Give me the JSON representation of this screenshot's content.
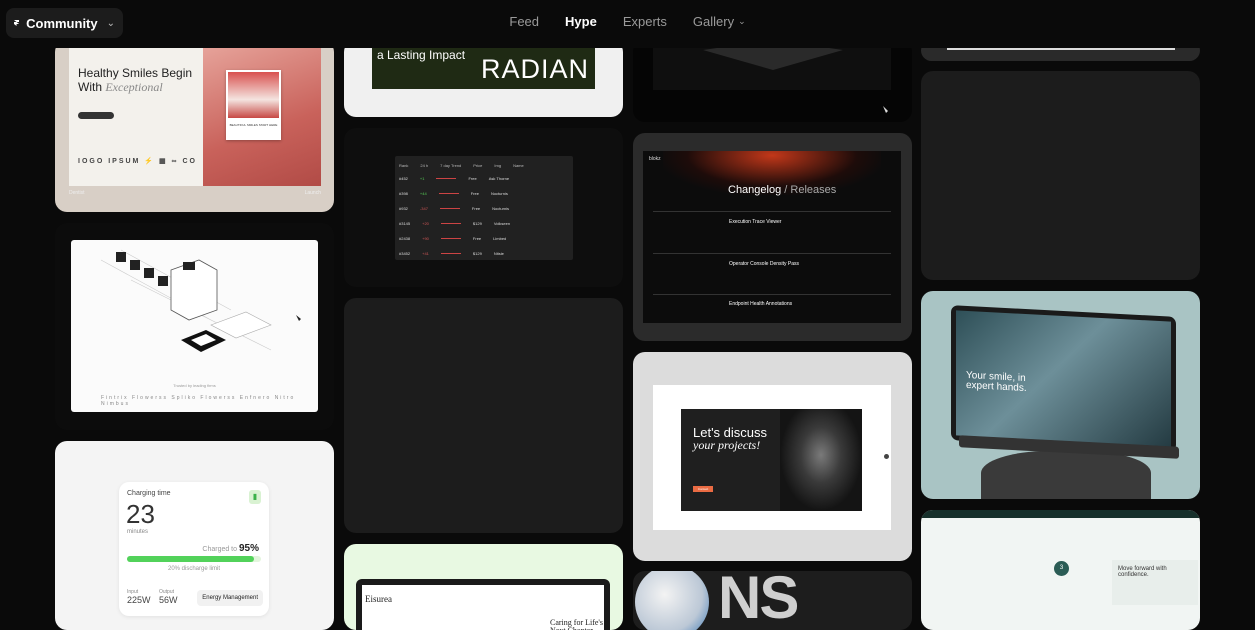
{
  "header": {
    "brand": "Community",
    "nav": [
      {
        "label": "Feed",
        "active": false
      },
      {
        "label": "Hype",
        "active": true
      },
      {
        "label": "Experts",
        "active": false
      },
      {
        "label": "Gallery",
        "active": false
      }
    ]
  },
  "cards": {
    "dental": {
      "headline": "Healthy Smiles Begin",
      "headline2": "With",
      "headline_em": "Exceptional",
      "logos": "IOGO IPSUM ⚡ ▦ ∞ CO",
      "foot_left": "Dentist",
      "foot_right": "Launch",
      "polaroid_caption": "BEAUTIFUL SMILES START HERE"
    },
    "isometric": {
      "caption": "Trusted by leading firms",
      "logos": "Fintrix  Flowerss  Spliko  Flowerss  Enfnero  Nitro  Nimbus"
    },
    "charging": {
      "label": "Charging time",
      "value": "23",
      "unit": "minutes",
      "charged_label": "Charged to",
      "charged_value": "95%",
      "charged_fraction": 0.95,
      "discharge": "20% discharge limit",
      "input_label": "Input",
      "input_value": "225W",
      "output_label": "Output",
      "output_value": "56W",
      "tag": "Energy Management"
    },
    "radian": {
      "headline": "a Lasting Impact",
      "brand": "RADIAN"
    },
    "table": {
      "headers": [
        "Rank",
        "24 h",
        "7 day Trend",
        "Price",
        "Img",
        "Name"
      ],
      "rows": [
        [
          "#452",
          "+1",
          "",
          "Free",
          "",
          "Ask Thorne"
        ],
        [
          "#398",
          "+44",
          "",
          "Free",
          "",
          "Nocturnis"
        ],
        [
          "#932",
          "-347",
          "",
          "Free",
          "",
          "Nocturnis"
        ],
        [
          "#3145",
          "+20",
          "",
          "$129",
          "",
          "Volkseen"
        ],
        [
          "#2438",
          "+90",
          "",
          "Free",
          "",
          "Limbed"
        ],
        [
          "#3452",
          "+41",
          "",
          "$129",
          "",
          "Nitsie"
        ]
      ]
    },
    "changelog": {
      "brand": "blokz",
      "title": "Changelog",
      "title_rest": "/ Releases",
      "entries": [
        "Execution Trace Viewer",
        "Operator Console Density Pass",
        "Endpoint Health Annotations"
      ]
    },
    "discuss": {
      "line1": "Let's discuss",
      "line2": "your projects!",
      "cta": "Contact"
    },
    "ns": {
      "text": "NS"
    },
    "laptop": {
      "headline": "Your smile, in expert hands."
    },
    "smile_health": {
      "step": "3",
      "message": "Move forward with confidence."
    },
    "eisurea": {
      "brand": "Eisurea",
      "headline": "Caring for Life's Next Chapter"
    }
  }
}
